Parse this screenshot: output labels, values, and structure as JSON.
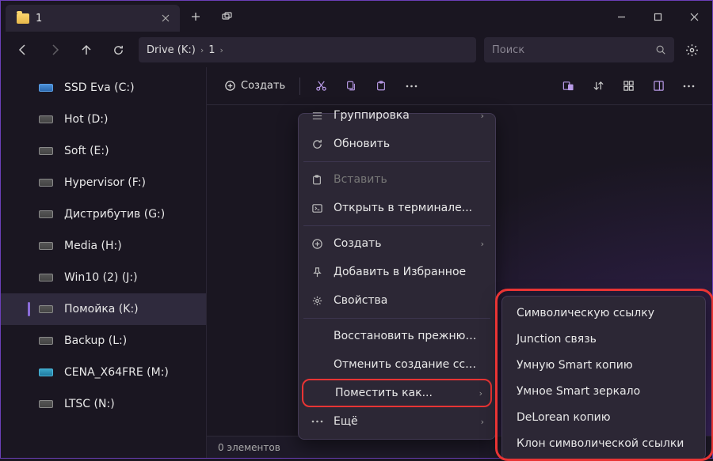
{
  "tab": {
    "title": "1"
  },
  "breadcrumb": {
    "part1": "Drive (K:)",
    "part2": "1"
  },
  "search": {
    "placeholder": "Поиск"
  },
  "sidebar": {
    "items": [
      {
        "label": "SSD Eva (C:)",
        "kind": "ssd"
      },
      {
        "label": "Hot (D:)",
        "kind": "hdd"
      },
      {
        "label": "Soft (E:)",
        "kind": "hdd"
      },
      {
        "label": "Hypervisor (F:)",
        "kind": "hdd"
      },
      {
        "label": "Дистрибутив (G:)",
        "kind": "hdd"
      },
      {
        "label": "Media (H:)",
        "kind": "hdd"
      },
      {
        "label": "Win10 (2) (J:)",
        "kind": "hdd"
      },
      {
        "label": "Помойка (K:)",
        "kind": "hdd",
        "selected": true
      },
      {
        "label": "Backup (L:)",
        "kind": "hdd"
      },
      {
        "label": "CENA_X64FRE (M:)",
        "kind": "media"
      },
      {
        "label": "LTSC (N:)",
        "kind": "hdd"
      }
    ]
  },
  "toolbar": {
    "create": "Создать"
  },
  "statusbar": {
    "count": "0 элементов"
  },
  "context_menu": {
    "items": [
      {
        "icon": "group",
        "label": "Группировка",
        "arrow": true,
        "clipped": true
      },
      {
        "icon": "refresh",
        "label": "Обновить"
      },
      {
        "sep": true
      },
      {
        "icon": "paste",
        "label": "Вставить",
        "disabled": true
      },
      {
        "icon": "terminal",
        "label": "Открыть в терминале..."
      },
      {
        "sep": true
      },
      {
        "icon": "plus-circle",
        "label": "Создать",
        "arrow": true
      },
      {
        "icon": "pin",
        "label": "Добавить в Избранное"
      },
      {
        "icon": "properties",
        "label": "Свойства"
      },
      {
        "sep": true
      },
      {
        "icon": "",
        "label": "Восстановить прежнюю ве..."
      },
      {
        "icon": "",
        "label": "Отменить создание ссылки"
      },
      {
        "icon": "",
        "label": "Поместить как...",
        "arrow": true,
        "highlight": true
      },
      {
        "icon": "dots",
        "label": "Ещё",
        "arrow": true
      }
    ]
  },
  "submenu": {
    "items": [
      "Символическую ссылку",
      "Junction связь",
      "Умную Smart копию",
      "Умное Smart зеркало",
      "DeLorean копию",
      "Клон символической ссылки"
    ]
  }
}
